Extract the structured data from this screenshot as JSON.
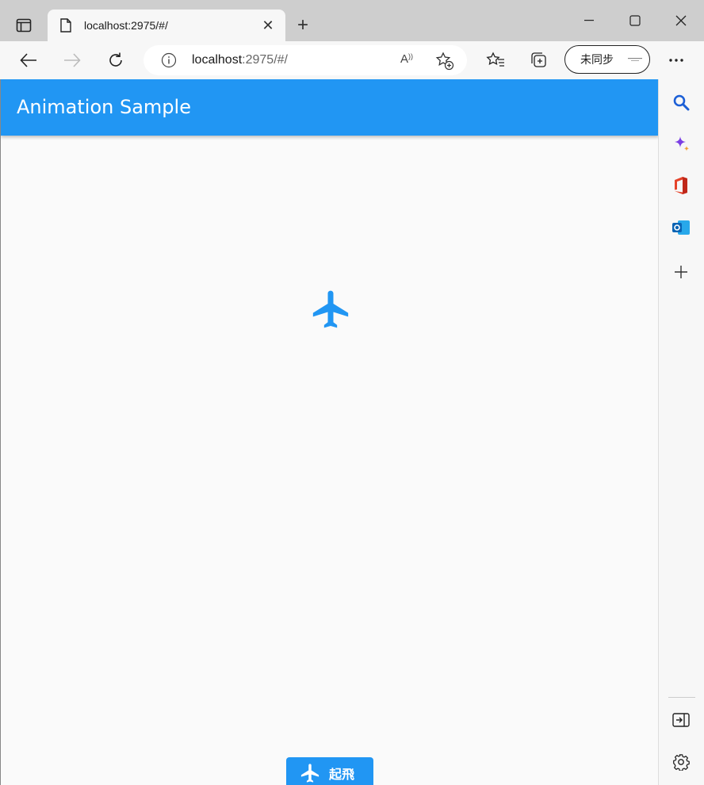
{
  "browser": {
    "tab_title": "localhost:2975/#/",
    "url_host": "localhost",
    "url_rest": ":2975/#/",
    "sync_label": "未同步",
    "read_aloud_label": "A",
    "new_tab_label": "+",
    "close_tab_label": "✕"
  },
  "app": {
    "title": "Animation Sample",
    "accent_color": "#2196f3",
    "takeoff_button_label": "起飛"
  },
  "icons": {
    "tab_actions": "tab-actions-icon",
    "page": "page-icon",
    "back": "back-arrow-icon",
    "forward": "forward-arrow-icon",
    "refresh": "refresh-icon",
    "info": "info-icon",
    "read_aloud": "read-aloud-icon",
    "add_favorite": "add-favorite-icon",
    "favorites": "favorites-icon",
    "collections": "collections-icon",
    "more": "more-icon",
    "search": "search-icon",
    "copilot": "copilot-icon",
    "office": "office-icon",
    "outlook": "outlook-icon",
    "add": "add-icon",
    "split_screen": "split-screen-icon",
    "settings": "settings-icon",
    "airplane": "airplane-icon"
  }
}
